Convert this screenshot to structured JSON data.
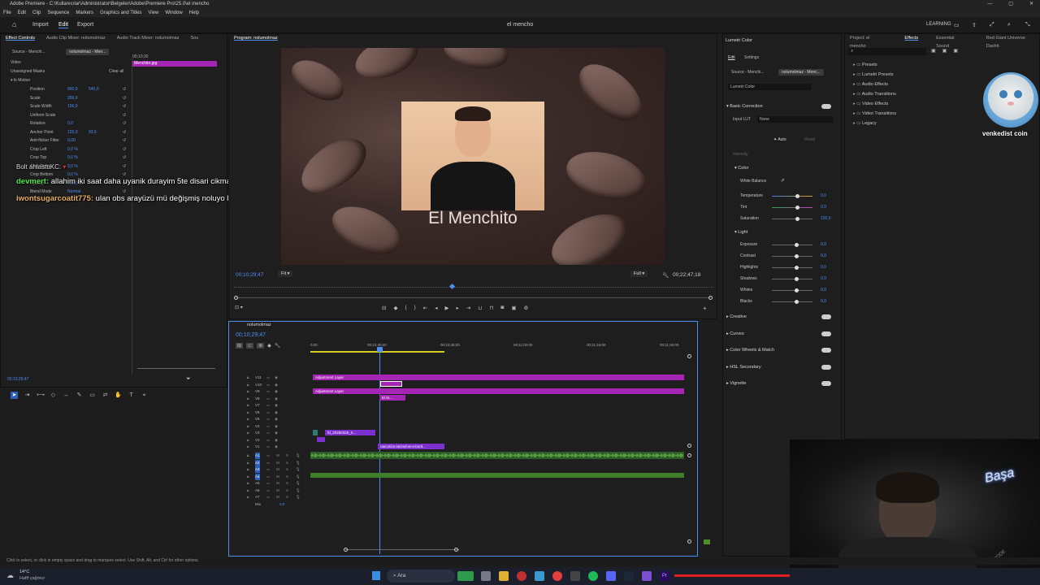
{
  "window": {
    "title": "Adobe Premiere - C:\\Kullanıcılar\\Administrator\\Belgeler\\Adobe\\Premiere Pro\\25.0\\el mencho",
    "controls": [
      "—",
      "▢",
      "✕"
    ]
  },
  "menu": [
    "File",
    "Edit",
    "Clip",
    "Sequence",
    "Markers",
    "Graphics and Titles",
    "View",
    "Window",
    "Help"
  ],
  "topnav": {
    "import": "Import",
    "edit": "Edit",
    "export": "Export",
    "project_name": "el mencho",
    "learning": "LEARNING"
  },
  "effect_controls": {
    "tabs": [
      "Effect Controls",
      "Audio Clip Mixer: nolumolmaz",
      "Audio Track Mixer: nolumolmaz",
      "Sou"
    ],
    "source": "Source - Menchi...",
    "sequence": "nolumolmaz - Men...",
    "timecode_top": "00;10;30",
    "clip_name": "Menchito.jpg",
    "video_label": "Video",
    "masks": "Unassigned Masks",
    "clear_all": "Clear all",
    "motion": "Motion",
    "props": [
      {
        "name": "Position",
        "v1": "960,0",
        "v2": "540,0"
      },
      {
        "name": "Scale",
        "v1": "289,0",
        "v2": ""
      },
      {
        "name": "Scale Width",
        "v1": "100,0",
        "v2": ""
      },
      {
        "name": "Uniform Scale",
        "v1": "",
        "v2": ""
      },
      {
        "name": "Rotation",
        "v1": "0,0",
        "v2": ""
      },
      {
        "name": "Anchor Point",
        "v1": "125,0",
        "v2": "93,5"
      },
      {
        "name": "Anti-flicker Filter",
        "v1": "0,00",
        "v2": ""
      },
      {
        "name": "Crop Left",
        "v1": "0,0 %",
        "v2": ""
      },
      {
        "name": "Crop Top",
        "v1": "0,0 %",
        "v2": ""
      },
      {
        "name": "Crop Right",
        "v1": "0,0 %",
        "v2": ""
      },
      {
        "name": "Crop Bottom",
        "v1": "0,0 %",
        "v2": ""
      },
      {
        "name": "Opacity",
        "v1": "100,0 %",
        "v2": ""
      },
      {
        "name": "Blend Mode",
        "v1": "Normal",
        "v2": ""
      }
    ],
    "bottom_timecode": "00;10;29;47"
  },
  "chat": [
    {
      "user": "Bolt ahlastuKC:",
      "msg": ""
    },
    {
      "user": "devmert:",
      "msg": "allahim iki saat daha uyanik durayim 5te disari cikmamlazim"
    },
    {
      "user": "iwontsugarcoatit775:",
      "msg": "ulan obs arayüzü mü değişmiş noluyo lan"
    }
  ],
  "program": {
    "tab": "Program: nolumolmaz",
    "caption": "El Menchito",
    "timecode": "00;10;29;47",
    "fit": "Fit",
    "quality": "Full",
    "duration": "00;22;47;18"
  },
  "timeline": {
    "tab": "nolumolmaz",
    "timecode": "00;10;29;47",
    "ruler": [
      "0;00",
      "00;10;30;00",
      "00;10;45;00",
      "00;11;00;00",
      "00;11;15;00",
      "00;11;30;00"
    ],
    "video_tracks": [
      "V11",
      "V10",
      "V9",
      "V8",
      "V7",
      "V6",
      "V5",
      "V4",
      "V3",
      "V2",
      "V1"
    ],
    "audio_tracks": [
      "A1",
      "A2",
      "A3",
      "A4",
      "A5",
      "A6",
      "A7"
    ],
    "mix": "Mix",
    "mix_val": "0,0",
    "clips": {
      "adj1": "Adjustment Layer",
      "adj2": "Adjustment Layer",
      "v3": "fd_20260326_0...",
      "v1": "narcotics-seized-at-a-bord...",
      "v9small": "El M...",
      "fx": "fx"
    }
  },
  "lumetri": {
    "title": "Lumetri Color",
    "tabs": [
      "Edit",
      "Settings"
    ],
    "source": "Source - Menchi...",
    "sequence": "nolumolmaz - Menc...",
    "dropdown": "Lumetri Color",
    "basic": "Basic Correction",
    "input_lut": "Input LUT",
    "lut_value": "None",
    "auto": "Auto",
    "reset": "Reset",
    "intensity": "Intensity",
    "color": "Color",
    "white_balance": "White Balance",
    "color_sliders": [
      {
        "name": "Temperature",
        "val": "0,0"
      },
      {
        "name": "Tint",
        "val": "0,0"
      },
      {
        "name": "Saturation",
        "val": "100,0"
      }
    ],
    "light": "Light",
    "light_sliders": [
      {
        "name": "Exposure",
        "val": "0,0"
      },
      {
        "name": "Contrast",
        "val": "0,0"
      },
      {
        "name": "Highlights",
        "val": "0,0"
      },
      {
        "name": "Shadows",
        "val": "0,0"
      },
      {
        "name": "Whites",
        "val": "0,0"
      },
      {
        "name": "Blacks",
        "val": "0,0"
      }
    ],
    "sections": [
      "Creative",
      "Curves",
      "Color Wheels & Match",
      "HSL Secondary",
      "Vignette"
    ]
  },
  "effects": {
    "tabs": [
      "Project: el mencho",
      "Effects",
      "Essential Sound",
      "Red Giant Universe Dashb"
    ],
    "folders": [
      "Presets",
      "Lumetri Presets",
      "Audio Effects",
      "Audio Transitions",
      "Video Effects",
      "Video Transitions",
      "Legacy"
    ],
    "overlay_text": "venkedist coin"
  },
  "webcam": {
    "neon": "Başa",
    "watermark": "RODE"
  },
  "status": "Click to select, or click in empty space and drag to marquee select. Use Shift, Alt, and Ctrl for other options.",
  "taskbar": {
    "weather_temp": "14°C",
    "weather_desc": "Hafif yağmur",
    "search": "Ara"
  },
  "colors": {
    "accent": "#4a8ff0",
    "adjustment": "#a526b5",
    "video": "#7d2fd0",
    "audio": "#2f5d2a",
    "waveform": "#7fd35a"
  }
}
